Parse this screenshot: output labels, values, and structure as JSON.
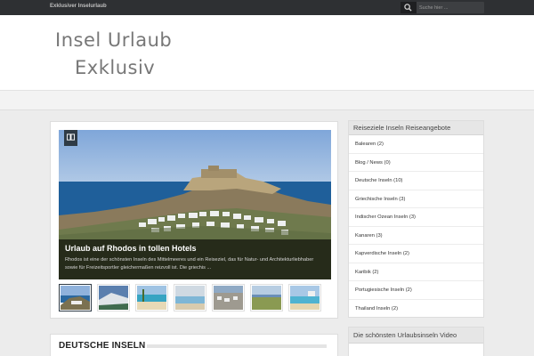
{
  "topbar": {
    "site_name": "Exklusiver Inselurlaub",
    "search_placeholder": "Suche hier ..."
  },
  "header": {
    "logo_line1": "Insel Urlaub",
    "logo_line2": "Exklusiv"
  },
  "slider": {
    "title": "Urlaub auf Rhodos in tollen Hotels",
    "excerpt": "Rhodos ist eine der schönsten Inseln des Mittelmeeres und ein Reiseziel, das für Natur- und Architekturliebhaber sowie für Freizeitsportler gleichermaßen reizvoll ist. Die griechis ...",
    "thumb_count": 7
  },
  "section": {
    "title": "DEUTSCHE INSELN"
  },
  "sidebar": {
    "widget1_title": "Reiseziele Inseln Reiseangebote",
    "categories": [
      {
        "label": "Balearen (2)"
      },
      {
        "label": "Blog / News (0)"
      },
      {
        "label": "Deutsche Inseln (10)"
      },
      {
        "label": "Griechische Inseln (3)"
      },
      {
        "label": "Indischer Ozean Inseln (3)"
      },
      {
        "label": "Kanaren (3)"
      },
      {
        "label": "Kapverdische Inseln (2)"
      },
      {
        "label": "Karibik (2)"
      },
      {
        "label": "Portugiesische Inseln (2)"
      },
      {
        "label": "Thailand Inseln (2)"
      }
    ],
    "widget2_title": "Die schönsten Urlaubsinseln Video"
  },
  "colors": {
    "topbar": "#2e3033",
    "badge": "#2f3b46",
    "page_bg": "#ececec"
  }
}
